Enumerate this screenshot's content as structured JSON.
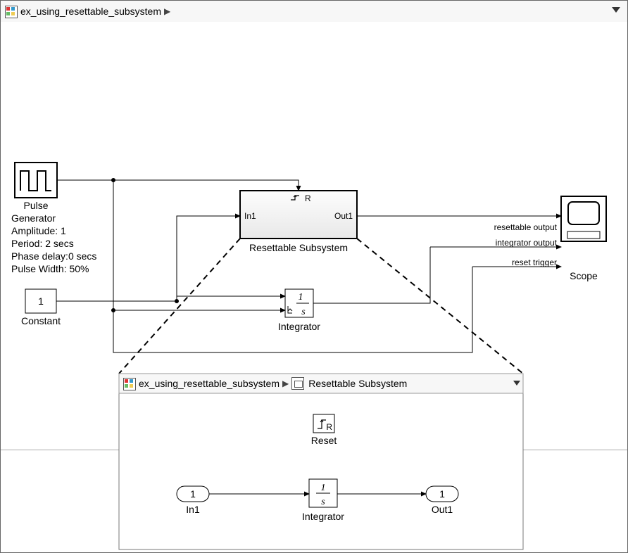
{
  "model_name": "ex_using_resettable_subsystem",
  "breadcrumb": {
    "root": "ex_using_resettable_subsystem",
    "child": "Resettable Subsystem"
  },
  "blocks": {
    "pulse": {
      "name": "Pulse",
      "subtitle": "Generator",
      "params": [
        "Amplitude: 1",
        "Period: 2 secs",
        "Phase delay:0 secs",
        "Pulse Width: 50%"
      ]
    },
    "constant": {
      "name": "Constant",
      "value": "1"
    },
    "resettable_subsystem": {
      "name": "Resettable Subsystem",
      "in_port": "In1",
      "out_port": "Out1",
      "reset_label": "R"
    },
    "integrator": {
      "name": "Integrator",
      "numer": "1",
      "denom": "s"
    },
    "scope": {
      "name": "Scope",
      "signal_labels": [
        "resettable output",
        "integrator output",
        "reset trigger"
      ]
    }
  },
  "inner": {
    "reset": {
      "name": "Reset",
      "label": "R"
    },
    "in1": {
      "name": "In1",
      "num": "1"
    },
    "integrator": {
      "name": "Integrator",
      "numer": "1",
      "denom": "s"
    },
    "out1": {
      "name": "Out1",
      "num": "1"
    }
  }
}
